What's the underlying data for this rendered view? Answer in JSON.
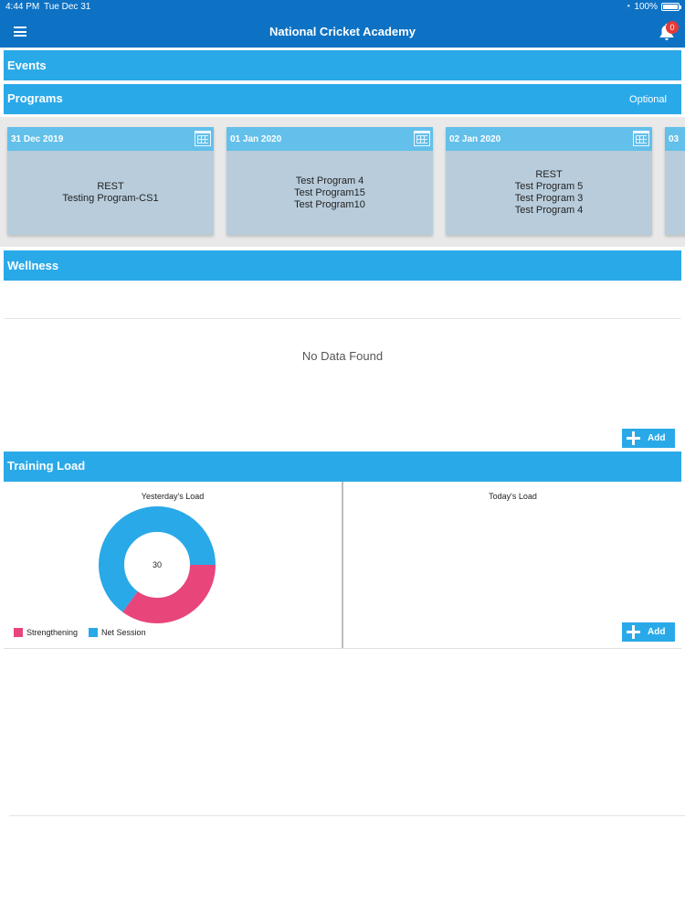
{
  "status_bar": {
    "time": "4:44 PM",
    "date": "Tue Dec 31",
    "battery": "100%"
  },
  "app": {
    "title": "National Cricket Academy",
    "notification_count": "0"
  },
  "sections": {
    "events": "Events",
    "programs": "Programs",
    "optional": "Optional",
    "wellness": "Wellness",
    "training_load": "Training Load"
  },
  "programs": [
    {
      "date": "31 Dec 2019",
      "items": [
        "REST",
        "Testing Program-CS1"
      ]
    },
    {
      "date": "01 Jan 2020",
      "items": [
        "Test Program 4",
        "Test Program15",
        "Test Program10"
      ]
    },
    {
      "date": "02 Jan 2020",
      "items": [
        "REST",
        "Test Program 5",
        "Test Program 3",
        "Test Program 4"
      ]
    },
    {
      "date": "03",
      "items": []
    }
  ],
  "wellness": {
    "empty_text": "No Data Found",
    "add_label": "Add"
  },
  "training_load": {
    "yesterday_title": "Yesterday's Load",
    "today_title": "Today's Load",
    "center_value": "30",
    "add_label": "Add"
  },
  "chart_data": {
    "type": "pie",
    "title": "Yesterday's Load",
    "categories": [
      "Strengthening",
      "Net Session"
    ],
    "values": [
      35,
      65
    ],
    "colors": [
      "#e8457a",
      "#2aa9e8"
    ],
    "center_label": "30",
    "legend": "bottom-left"
  }
}
